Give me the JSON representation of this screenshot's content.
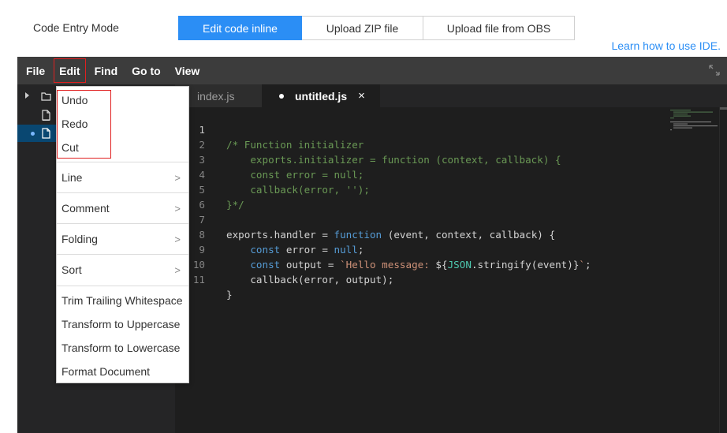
{
  "page": {
    "mode_label": "Code Entry Mode",
    "mode_tabs": [
      "Edit code inline",
      "Upload ZIP file",
      "Upload file from OBS"
    ],
    "learn_link": "Learn how to use IDE."
  },
  "menubar": {
    "items": [
      "File",
      "Edit",
      "Find",
      "Go to",
      "View"
    ],
    "expand_icon": "expand-icon"
  },
  "editor_tabs": [
    {
      "label": "index.js",
      "active": false
    },
    {
      "label": "untitled.js",
      "active": true,
      "modified": true,
      "close": "×"
    }
  ],
  "edit_menu": {
    "items": [
      {
        "label": "Undo"
      },
      {
        "label": "Redo"
      },
      {
        "label": "Cut"
      },
      {
        "label": "Line",
        "arrow": ">"
      },
      {
        "label": "Comment",
        "arrow": ">"
      },
      {
        "label": "Folding",
        "arrow": ">"
      },
      {
        "label": "Sort",
        "arrow": ">"
      },
      {
        "label": "Trim Trailing Whitespace"
      },
      {
        "label": "Transform to Uppercase"
      },
      {
        "label": "Transform to Lowercase"
      },
      {
        "label": "Format Document"
      }
    ]
  },
  "code": {
    "line_numbers": [
      "1",
      "2",
      "3",
      "4",
      "5",
      "6",
      "7",
      "8",
      "9",
      "10",
      "11"
    ],
    "lines": [
      "/* Function initializer",
      "    exports.initializer = function (context, callback) {",
      "    const error = null;",
      "    callback(error, '');",
      "}*/",
      "",
      "exports.handler = function (event, context, callback) {",
      "    const error = null;",
      "    const output = `Hello message: ${JSON.stringify(event)}`;",
      "    callback(error, output);",
      "}"
    ]
  },
  "colors": {
    "accent": "#2b8ef5",
    "highlight_box": "#e02020",
    "comment": "#6a9955",
    "keyword": "#569cd6",
    "string": "#ce9178"
  }
}
